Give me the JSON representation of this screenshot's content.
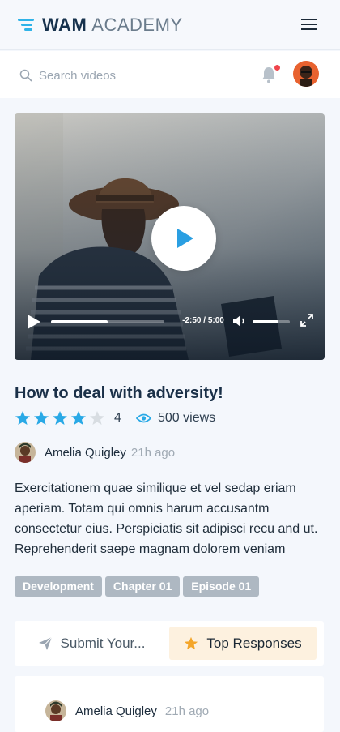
{
  "brand": {
    "name_bold": "WAM",
    "name_light": "ACADEMY",
    "accent": "#2fb3e8"
  },
  "header": {
    "menu_icon": "hamburger-icon"
  },
  "search": {
    "placeholder": "Search videos",
    "icon": "search-icon"
  },
  "notifications": {
    "icon": "bell-icon",
    "has_unread": true,
    "dot_color": "#f0444b"
  },
  "video": {
    "time_display": "-2:50 / 5:00",
    "progress": 0.5,
    "volume": 0.7
  },
  "post": {
    "title": "How to deal with adversity!",
    "rating": 4,
    "rating_max": 5,
    "rating_label": "4",
    "views": "500 views",
    "star_color": "#29a9e6",
    "author": {
      "name": "Amelia Quigley",
      "time": "21h ago"
    },
    "description": "Exercitationem quae similique et vel sedap eriam aperiam. Totam qui omnis harum accusantm consectetur eius. Perspiciatis sit adipisci recu and ut. Reprehenderit saepe magnam dolorem veniam",
    "tags": [
      "Development",
      "Chapter 01",
      "Episode 01"
    ]
  },
  "tabs": {
    "submit_label": "Submit Your...",
    "top_label": "Top Responses",
    "active": "top"
  },
  "responses": [
    {
      "author": "Amelia Quigley",
      "time": "21h ago"
    }
  ]
}
